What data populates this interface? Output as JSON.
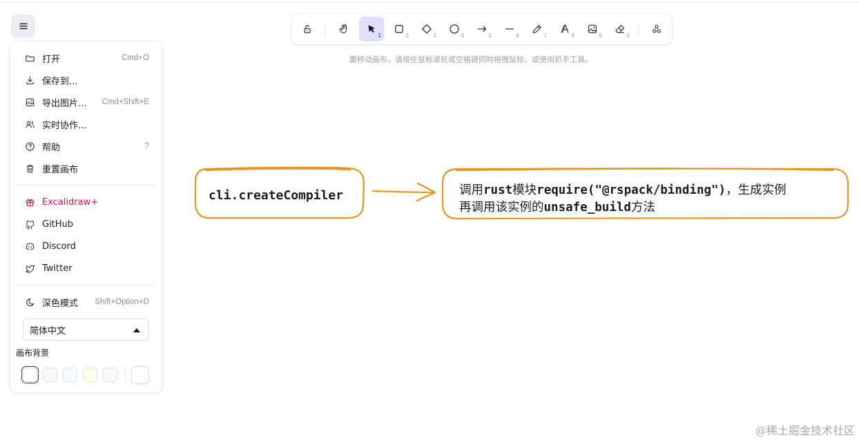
{
  "menu": {
    "items": [
      {
        "label": "打开",
        "shortcut": "Cmd+O",
        "icon": "folder-icon"
      },
      {
        "label": "保存到...",
        "shortcut": "",
        "icon": "download-icon"
      },
      {
        "label": "导出图片...",
        "shortcut": "Cmd+Shift+E",
        "icon": "export-image-icon"
      },
      {
        "label": "实时协作...",
        "shortcut": "",
        "icon": "users-icon"
      },
      {
        "label": "帮助",
        "shortcut": "?",
        "icon": "help-icon"
      },
      {
        "label": "重置画布",
        "shortcut": "",
        "icon": "trash-icon"
      }
    ],
    "links": [
      {
        "label": "Excalidraw+",
        "icon": "gift-icon"
      },
      {
        "label": "GitHub",
        "icon": "github-icon"
      },
      {
        "label": "Discord",
        "icon": "discord-icon"
      },
      {
        "label": "Twitter",
        "icon": "twitter-icon"
      }
    ],
    "dark_mode": {
      "label": "深色模式",
      "shortcut": "Shift+Option+D"
    },
    "language": "简体中文",
    "canvas_bg_label": "画布背景",
    "bg_colors": [
      "#ffffff",
      "#f8f9fa",
      "#f5faff",
      "#fffce8",
      "#fdf8f6"
    ],
    "selected_bg": "#ffffff"
  },
  "toolbar": {
    "tools": [
      {
        "name": "lock",
        "key": ""
      },
      {
        "name": "hand",
        "key": ""
      },
      {
        "name": "selection",
        "key": "1"
      },
      {
        "name": "rectangle",
        "key": "2"
      },
      {
        "name": "diamond",
        "key": "3"
      },
      {
        "name": "ellipse",
        "key": "4"
      },
      {
        "name": "arrow",
        "key": "5"
      },
      {
        "name": "line",
        "key": "6"
      },
      {
        "name": "draw",
        "key": "7"
      },
      {
        "name": "text",
        "key": "8"
      },
      {
        "name": "image",
        "key": "9"
      },
      {
        "name": "eraser",
        "key": "0"
      },
      {
        "name": "extra-tools",
        "key": ""
      }
    ],
    "active_tool": "selection"
  },
  "hint": "要移动画布，请按住鼠标滚轮或空格键同时拖拽鼠标，或使用抓手工具。",
  "canvas": {
    "box1_text": "cli.createCompiler",
    "box2": {
      "line1_a": "调用",
      "line1_b": "rust",
      "line1_c": "模块",
      "line1_d": "require(\"@rspack/binding\")",
      "line1_e": "，生成实例",
      "line2_a": "再调用该实例的",
      "line2_b": "unsafe_build",
      "line2_c": "方法"
    },
    "stroke_color": "#e8951c"
  },
  "watermark": "@稀土掘金技术社区"
}
